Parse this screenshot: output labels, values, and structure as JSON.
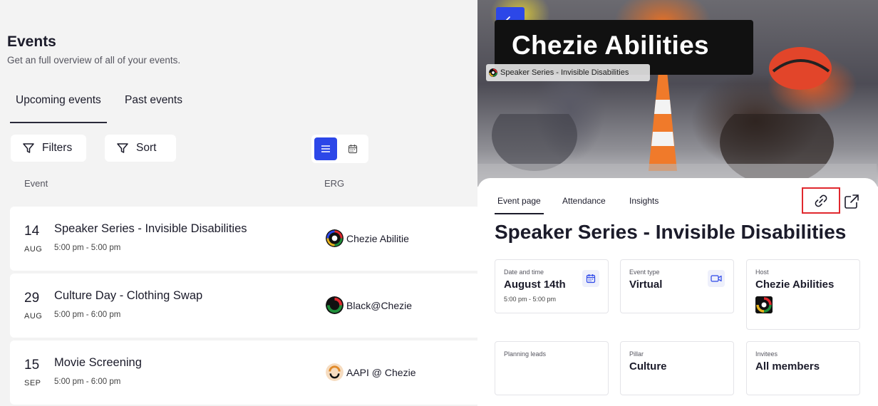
{
  "page": {
    "title": "Events",
    "subtitle": "Get an full overview of all of your events."
  },
  "tabs": {
    "upcoming": "Upcoming events",
    "past": "Past events"
  },
  "toolbar": {
    "filters_label": "Filters",
    "sort_label": "Sort"
  },
  "columns": {
    "event": "Event",
    "erg": "ERG"
  },
  "events": [
    {
      "day": "14",
      "month": "AUG",
      "name": "Speaker Series - Invisible Disabilities",
      "time": "5:00 pm - 5:00 pm",
      "erg": "Chezie Abilitie",
      "erg_logo_color": "#e6b31e"
    },
    {
      "day": "29",
      "month": "AUG",
      "name": "Culture Day - Clothing Swap",
      "time": "5:00 pm - 6:00 pm",
      "erg": "Black@Chezie",
      "erg_logo_color": "#1f8f3a"
    },
    {
      "day": "15",
      "month": "SEP",
      "name": "Movie Screening",
      "time": "5:00 pm - 6:00 pm",
      "erg": "AAPI @ Chezie",
      "erg_logo_color": "#f2c9a0"
    }
  ],
  "detail": {
    "hero_title": "Chezie Abilities",
    "hero_chip": "Speaker Series - Invisible Disabilities",
    "tabs": [
      "Event page",
      "Attendance",
      "Insights"
    ],
    "event_title": "Speaker Series - Invisible Disabilities",
    "cards": {
      "date": {
        "label": "Date and time",
        "value": "August 14th",
        "sub": "5:00 pm - 5:00 pm"
      },
      "type": {
        "label": "Event type",
        "value": "Virtual"
      },
      "host": {
        "label": "Host",
        "value": "Chezie Abilities"
      },
      "leads": {
        "label": "Planning leads",
        "value": ""
      },
      "pillar": {
        "label": "Pillar",
        "value": "Culture"
      },
      "invitees": {
        "label": "Invitees",
        "value": "All members"
      }
    }
  },
  "colors": {
    "accent": "#2c47e8",
    "highlight": "#e0282e"
  }
}
